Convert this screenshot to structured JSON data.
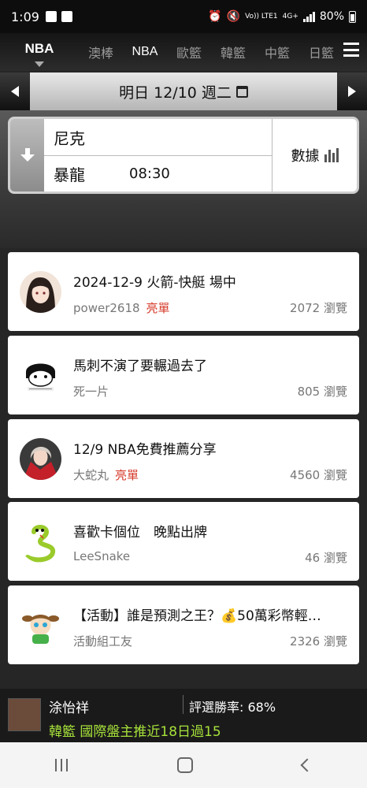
{
  "status_bar": {
    "time": "1:09",
    "network": "4G+",
    "volte": "Vo)) LTE1",
    "battery": "80%"
  },
  "tabs": {
    "active": "NBA",
    "items": [
      "澳棒",
      "NBA",
      "歐籃",
      "韓籃",
      "中籃",
      "日籃"
    ]
  },
  "date_bar": {
    "label": "明日 12/10 週二"
  },
  "game": {
    "away_team": "尼克",
    "home_team": "暴龍",
    "time": "08:30",
    "data_label": "數據"
  },
  "posts": [
    {
      "title": "2024-12-9 火箭-快艇 場中",
      "author": "power2618",
      "badge": "亮單",
      "views": "2072 瀏覽",
      "avatar": "anime-girl-avatar"
    },
    {
      "title": "馬刺不演了要輾過去了",
      "author": "死一片",
      "badge": "",
      "views": "805 瀏覽",
      "avatar": "meme-avatar"
    },
    {
      "title": "12/9 NBA免費推薦分享",
      "author": "大蛇丸",
      "badge": "亮單",
      "views": "4560 瀏覽",
      "avatar": "red-girl-avatar"
    },
    {
      "title": "喜歡卡個位　晚點出牌",
      "author": "LeeSnake",
      "badge": "",
      "views": "46 瀏覽",
      "avatar": "snake-avatar"
    },
    {
      "title": "【活動】誰是預測之王？💰50萬彩幣輕…",
      "author": "活動組工友",
      "badge": "",
      "views": "2326 瀏覽",
      "avatar": "mascot-avatar"
    }
  ],
  "bottom_bar": {
    "name": "涂怡祥",
    "rate": "評選勝率: 68%",
    "pick": "韓籃 國際盤主推近18日過15"
  },
  "colors": {
    "badge": "#d63b2b",
    "pick": "#a7e23a"
  }
}
